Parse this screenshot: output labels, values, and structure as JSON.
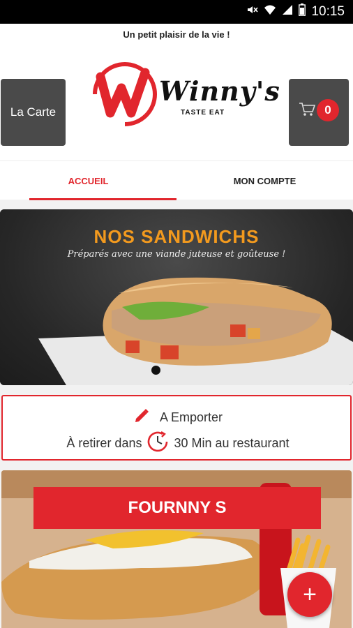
{
  "status_bar": {
    "time": "10:15"
  },
  "header": {
    "tagline": "Un petit plaisir de la vie !",
    "menu_label": "La Carte",
    "cart_count": "0",
    "brand_name": "Winny's",
    "brand_tagline": "TASTE EAT"
  },
  "tabs": [
    {
      "label": "ACCUEIL",
      "active": true
    },
    {
      "label": "MON COMPTE",
      "active": false
    }
  ],
  "banner": {
    "title": "NOS SANDWICHS",
    "subtitle": "Préparés avec une viande juteuse et goûteuse !"
  },
  "order_info": {
    "mode": "A Emporter",
    "pickup_prefix": "À retirer dans",
    "pickup_time": "30 Min au restaurant"
  },
  "product": {
    "name": "FOURNNY S"
  },
  "colors": {
    "accent": "#e1262d",
    "banner_title": "#f39a1e",
    "button_bg": "#4a4a4a"
  },
  "icons": [
    "mute-icon",
    "wifi-icon",
    "signal-icon",
    "battery-icon",
    "cart-icon",
    "pencil-icon",
    "clock-icon",
    "plus-icon"
  ]
}
